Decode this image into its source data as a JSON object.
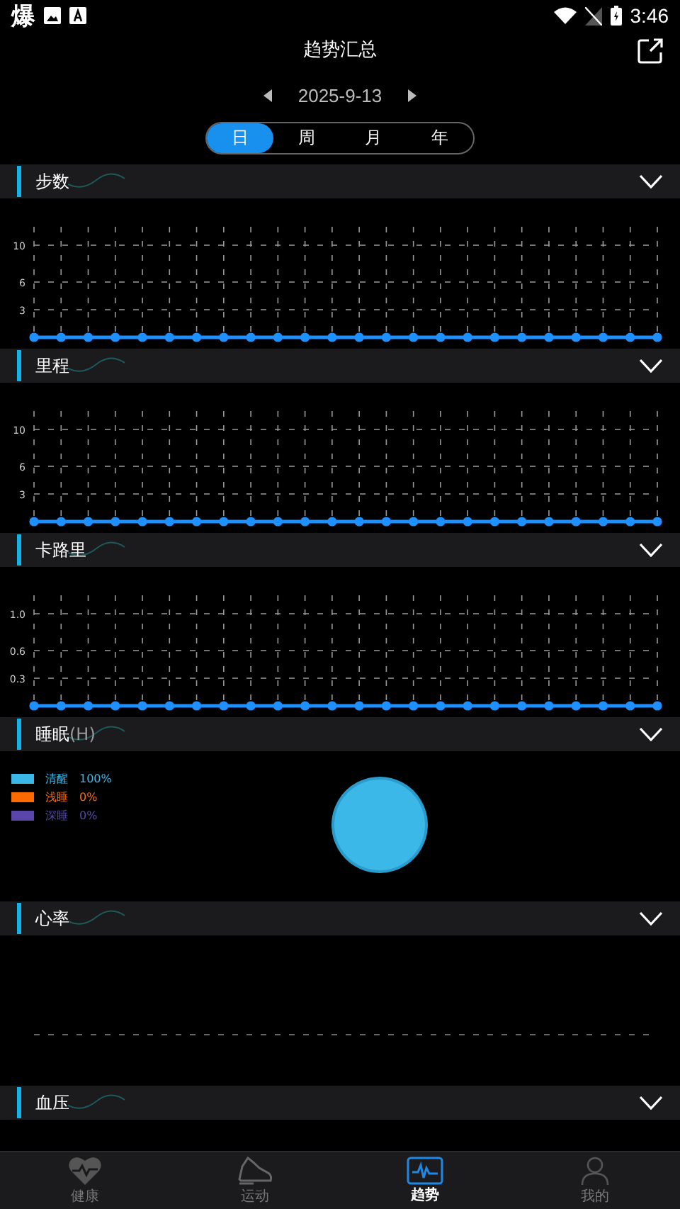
{
  "status_bar": {
    "notification": "爆",
    "time": "3:46"
  },
  "header": {
    "title": "趋势汇总"
  },
  "date_nav": {
    "date": "2025-9-13"
  },
  "period_tabs": [
    {
      "label": "日",
      "selected": true
    },
    {
      "label": "周",
      "selected": false
    },
    {
      "label": "月",
      "selected": false
    },
    {
      "label": "年",
      "selected": false
    }
  ],
  "sections": [
    {
      "title": "步数",
      "chart_data": {
        "type": "line",
        "ylim": [
          0,
          12
        ],
        "yticks": [
          3,
          6,
          10
        ],
        "grid": true,
        "series": [
          {
            "marker": true,
            "color": "#1e90ff",
            "values": [
              0,
              0,
              0,
              0,
              0,
              0,
              0,
              0,
              0,
              0,
              0,
              0,
              0,
              0,
              0,
              0,
              0,
              0,
              0,
              0,
              0,
              0,
              0,
              0
            ]
          }
        ]
      }
    },
    {
      "title": "里程",
      "chart_data": {
        "type": "line",
        "ylim": [
          0,
          12
        ],
        "yticks": [
          3,
          6,
          10
        ],
        "grid": true,
        "series": [
          {
            "marker": true,
            "color": "#1e90ff",
            "values": [
              0,
              0,
              0,
              0,
              0,
              0,
              0,
              0,
              0,
              0,
              0,
              0,
              0,
              0,
              0,
              0,
              0,
              0,
              0,
              0,
              0,
              0,
              0,
              0
            ]
          }
        ]
      }
    },
    {
      "title": "卡路里",
      "chart_data": {
        "type": "line",
        "ylim": [
          0,
          1.2
        ],
        "yticks": [
          {
            "value": 0.3,
            "label": "0.3"
          },
          {
            "value": 0.6,
            "label": "0.6"
          },
          {
            "value": 1,
            "label": "1.0"
          }
        ],
        "grid": true,
        "series": [
          {
            "marker": true,
            "color": "#1e90ff",
            "values": [
              0,
              0,
              0,
              0,
              0,
              0,
              0,
              0,
              0,
              0,
              0,
              0,
              0,
              0,
              0,
              0,
              0,
              0,
              0,
              0,
              0,
              0,
              0,
              0
            ]
          }
        ]
      }
    },
    {
      "title": "睡眠",
      "unit": "(H)",
      "legend": [
        {
          "label": "清醒",
          "value": "100%",
          "color": "#3bb8e8"
        },
        {
          "label": "浅睡",
          "value": "0%",
          "color": "#ff6a00"
        },
        {
          "label": "深睡",
          "value": "0%",
          "color": "#5a46a8"
        }
      ],
      "chart_data": {
        "type": "pie",
        "values": [
          100,
          0,
          0
        ]
      }
    },
    {
      "title": "心率"
    },
    {
      "title": "血压"
    }
  ],
  "bottom_nav": [
    {
      "label": "健康",
      "selected": false
    },
    {
      "label": "运动",
      "selected": false
    },
    {
      "label": "趋势",
      "selected": true
    },
    {
      "label": "我的",
      "selected": false
    }
  ]
}
